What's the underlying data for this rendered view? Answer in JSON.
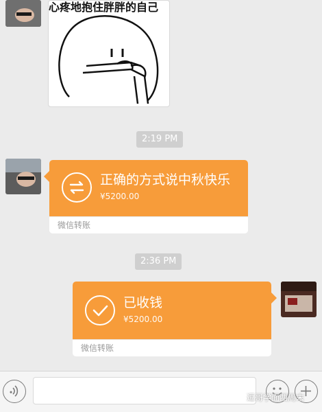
{
  "sticker": {
    "caption": "心疼地抱住胖胖的自己"
  },
  "messages": {
    "timestamp_1": "2:19 PM",
    "timestamp_2": "2:36 PM",
    "transfer_sent": {
      "title": "正确的方式说中秋快乐",
      "amount": "¥5200.00",
      "footer": "微信转账",
      "icon": "transfer-arrows-icon"
    },
    "transfer_received": {
      "title": "已收钱",
      "amount": "¥5200.00",
      "footer": "微信转账",
      "icon": "checkmark-icon"
    }
  },
  "input_bar": {
    "voice_icon": "voice-icon",
    "emoji_icon": "emoji-icon",
    "plus_icon": "plus-icon"
  },
  "watermark": "逗哥学面西周末",
  "colors": {
    "transfer_orange": "#f79c3a",
    "chat_background": "#ebebeb"
  }
}
